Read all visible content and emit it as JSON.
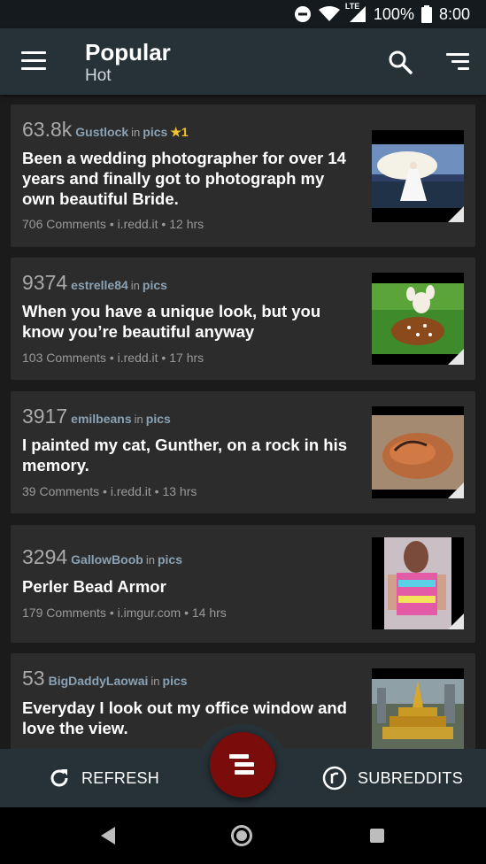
{
  "status_bar": {
    "network": "LTE",
    "battery": "100%",
    "time": "8:00"
  },
  "app_bar": {
    "title": "Popular",
    "subtitle": "Hot"
  },
  "posts": [
    {
      "score": "63.8k",
      "author": "Gustlock",
      "in_label": "in",
      "subreddit": "pics",
      "gilded": "★1",
      "title": "Been a wedding photographer for over 14 years and finally got to photograph my own beautiful Bride.",
      "comments": "706 Comments",
      "domain": "i.redd.it",
      "age": "12 hrs"
    },
    {
      "score": "9374",
      "author": "estrelle84",
      "in_label": "in",
      "subreddit": "pics",
      "title": "When you have a unique look, but you know you’re beautiful anyway",
      "comments": "103 Comments",
      "domain": "i.redd.it",
      "age": "17 hrs"
    },
    {
      "score": "3917",
      "author": "emilbeans",
      "in_label": "in",
      "subreddit": "pics",
      "title": "I painted my cat, Gunther, on a rock in his memory.",
      "comments": "39 Comments",
      "domain": "i.redd.it",
      "age": "13 hrs"
    },
    {
      "score": "3294",
      "author": "GallowBoob",
      "in_label": "in",
      "subreddit": "pics",
      "title": "Perler Bead Armor",
      "comments": "179 Comments",
      "domain": "i.imgur.com",
      "age": "14 hrs"
    },
    {
      "score": "53",
      "author": "BigDaddyLaowai",
      "in_label": "in",
      "subreddit": "pics",
      "title": "Everyday I look out my office window and love the view."
    }
  ],
  "bottom_bar": {
    "refresh_label": "REFRESH",
    "subreddits_label": "SUBREDDITS"
  },
  "colors": {
    "app_bar": "#263238",
    "background": "#1b1b1c",
    "card": "#2c2c2d",
    "fab": "#7a0c0c",
    "link": "#8aa2b3",
    "gold": "#f2c12e"
  },
  "icons": [
    "menu-icon",
    "search-icon",
    "sort-icon",
    "refresh-icon",
    "subreddits-icon",
    "fab-icon",
    "back-icon",
    "home-icon",
    "recents-icon"
  ]
}
